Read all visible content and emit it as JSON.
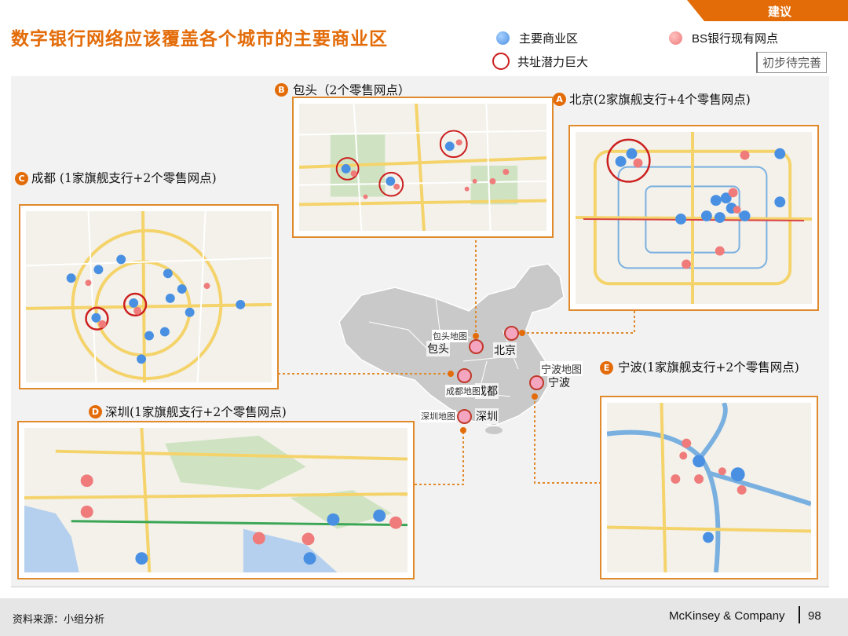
{
  "tag": {
    "label": "建议",
    "color": "#e36c09"
  },
  "title": "数字银行网络应该覆盖各个城市的主要商业区",
  "legend": [
    {
      "label": "主要商业区",
      "marker": "blue-dot",
      "color": "#4a90e2"
    },
    {
      "label": "BS银行现有网点",
      "marker": "pink-dot",
      "color": "#ef7b7b"
    },
    {
      "label": "共址潜力巨大",
      "marker": "red-ring",
      "color": "#cc1f1f"
    }
  ],
  "stamp": "初步待完善",
  "cities": [
    {
      "badge": "A",
      "caption": "北京(2家旗舰支行+4个零售网点)",
      "map_label": "北京"
    },
    {
      "badge": "B",
      "caption": "包头（2个零售网点）",
      "map_label": "包头",
      "map_small_label": "包头地图"
    },
    {
      "badge": "C",
      "caption": "成都 (1家旗舰支行+2个零售网点)",
      "map_label": "成都",
      "map_small_label": "成都地图"
    },
    {
      "badge": "D",
      "caption": "深圳(1家旗舰支行+2个零售网点)",
      "map_label": "深圳",
      "map_small_label": "深圳地图"
    },
    {
      "badge": "E",
      "caption": "宁波(1家旗舰支行+2个零售网点)",
      "map_label": "宁波",
      "map_small_label": "宁波地图"
    }
  ],
  "footer": {
    "source": "资料来源：小组分析",
    "brand": "McKinsey & Company",
    "page": "98"
  }
}
